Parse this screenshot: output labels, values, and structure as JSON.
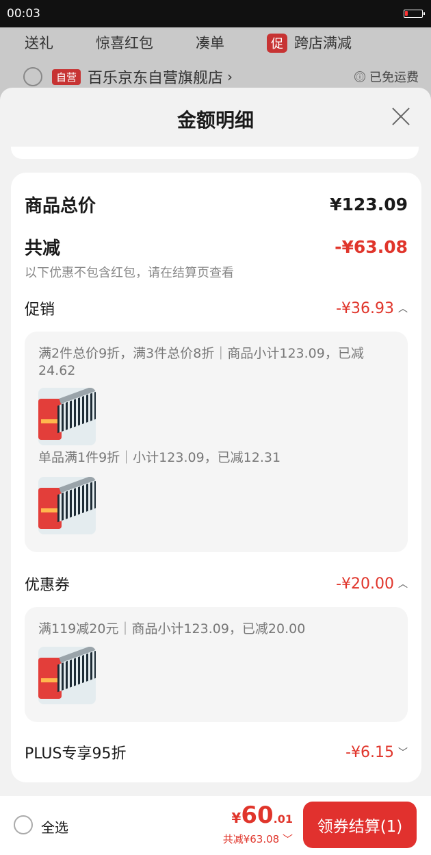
{
  "status_bar": {
    "time": "00:03",
    "battery_level": 0.15
  },
  "background": {
    "promo_tabs": [
      "送礼",
      "惊喜红包",
      "凑单"
    ],
    "promo_tag": "促",
    "promo_cross_store": "跨店满减",
    "store_tag": "自营",
    "store_name": "百乐京东自营旗舰店",
    "store_chevron": "›",
    "shipping_icon": "ⓘ",
    "shipping": "已免运费"
  },
  "sheet": {
    "title": "金额明细",
    "total": {
      "label": "商品总价",
      "value": "¥123.09"
    },
    "reduction": {
      "label": "共减",
      "value": "-¥63.08",
      "note": "以下优惠不包含红包，请在结算页查看"
    },
    "promotion": {
      "label": "促销",
      "value": "-¥36.93",
      "items": [
        {
          "desc": "满2件总价9折，满3件总价8折｜商品小计123.09，已减24.62"
        },
        {
          "desc": "单品满1件9折｜小计123.09，已减12.31"
        }
      ]
    },
    "coupon": {
      "label": "优惠券",
      "value": "-¥20.00",
      "items": [
        {
          "desc": "满119减20元｜商品小计123.09，已减20.00"
        }
      ]
    },
    "plus": {
      "label": "PLUS专享95折",
      "value": "-¥6.15"
    }
  },
  "footer": {
    "select_all": "全选",
    "currency": "¥",
    "pay_int": "60",
    "pay_dec": ".01",
    "reduced": "共减¥63.08",
    "checkout_label": "领券结算(1)"
  }
}
